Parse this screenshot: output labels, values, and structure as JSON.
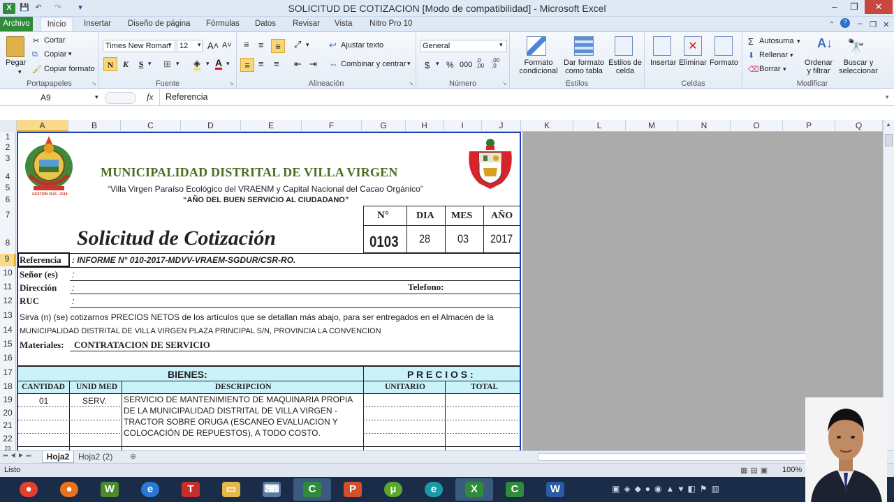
{
  "window": {
    "title": "SOLICITUD DE COTIZACION  [Modo de compatibilidad] - Microsoft Excel",
    "minimize": "–",
    "restore": "❐",
    "close": "✕"
  },
  "ribbon_tabs": [
    "Archivo",
    "Inicio",
    "Insertar",
    "Diseño de página",
    "Fórmulas",
    "Datos",
    "Revisar",
    "Vista",
    "Nitro Pro 10"
  ],
  "ribbon": {
    "portapapeles": {
      "paste": "Pegar",
      "cut": "Cortar",
      "copy": "Copiar",
      "format_painter": "Copiar formato",
      "label": "Portapapeles"
    },
    "fuente": {
      "font_name": "Times New Roman",
      "font_size": "12",
      "bold": "N",
      "italic": "K",
      "underline": "S",
      "label": "Fuente"
    },
    "alineacion": {
      "wrap": "Ajustar texto",
      "merge": "Combinar y centrar",
      "label": "Alineación"
    },
    "numero": {
      "format": "General",
      "currency": "$",
      "percent": "%",
      "thousands": "000",
      "inc": ",0 ,00",
      "dec": ",00 ,0",
      "label": "Número"
    },
    "estilos": {
      "conditional": "Formato condicional",
      "as_table": "Dar formato como tabla",
      "cell_styles": "Estilos de celda",
      "label": "Estilos"
    },
    "celdas": {
      "insert": "Insertar",
      "delete": "Eliminar",
      "format": "Formato",
      "label": "Celdas"
    },
    "modificar": {
      "autosum": "Autosuma",
      "fill": "Rellenar",
      "clear": "Borrar",
      "sort": "Ordenar y filtrar",
      "find": "Buscar y seleccionar",
      "label": "Modificar"
    }
  },
  "formula_bar": {
    "name_box": "A9",
    "fx": "fx",
    "content": "Referencia"
  },
  "columns": [
    "A",
    "B",
    "C",
    "D",
    "E",
    "F",
    "G",
    "H",
    "I",
    "J",
    "K",
    "L",
    "M",
    "N",
    "O",
    "P",
    "Q"
  ],
  "rows": [
    "1",
    "2",
    "3",
    "4",
    "5",
    "6",
    "7",
    "8",
    "9",
    "10",
    "11",
    "12",
    "13",
    "14",
    "15",
    "16",
    "17",
    "18",
    "19",
    "20",
    "21",
    "22",
    "23"
  ],
  "document": {
    "logo_text": "GESTIÓN 2015 - 2018",
    "municipality": "MUNICIPALIDAD DISTRITAL DE VILLA VIRGEN",
    "slogan": "“Villa Virgen Paraíso Ecológico del VRAENM y Capital Nacional  del Cacao Orgánico”",
    "year_name": "“AÑO DEL BUEN SERVICIO AL CIUDADANO”",
    "title": "Solicitud de Cotización",
    "num_header": "N°",
    "num_value": "0103",
    "dia_header": "DIA",
    "dia_value": "28",
    "mes_header": "MES",
    "mes_value": "03",
    "anio_header": "AÑO",
    "anio_value": "2017",
    "referencia_label": "Referencia",
    "referencia_value": ": INFORME N° 010-2017-MDVV-VRAEM-SGDUR/CSR-RO.",
    "senor_label": "Señor (es)",
    "direccion_label": "Dirección",
    "ruc_label": "RUC",
    "colon": ":",
    "telefono_label": "Telefono:",
    "intro_line1": "Sirva  (n)  (se)  cotizarnos  PRECIOS  NETOS   de  los artículos  que  se  detallan  más  abajo, para ser entregados en el Almacén de la",
    "intro_line2": "MUNICIPALIDAD DISTRITAL DE VILLA VIRGEN  PLAZA PRINCIPAL S/N, PROVINCIA LA CONVENCION",
    "materiales_label": "Materiales:",
    "materiales_value": "CONTRATACION DE SERVICIO",
    "bienes_header": "BIENES:",
    "precios_header": "P R E C I O S :",
    "col_cantidad": "CANTIDAD",
    "col_unidad": "UNID MED",
    "col_descripcion": "DESCRIPCION",
    "col_unitario": "UNITARIO",
    "col_total": "TOTAL",
    "item_cantidad": "01",
    "item_unidad": "SERV.",
    "item_desc_1": "SERVICIO DE MANTENIMIENTO DE MAQUINARIA PROPIA",
    "item_desc_2": "DE  LA  MUNICIPALIDAD  DISTRITAL  DE  VILLA  VIRGEN  -",
    "item_desc_3": "TRACTOR  SOBRE  ORUGA  (ESCANEO  EVALUACION  Y",
    "item_desc_4": "COLOCACIÓN DE REPUESTOS), A TODO COSTO."
  },
  "sheet_tabs": [
    "Hoja2",
    "Hoja2 (2)"
  ],
  "status": {
    "ready": "Listo",
    "zoom": "100%"
  },
  "colors": {
    "excel_green": "#2e8b3a",
    "title_green": "#4d6b1f",
    "header_cyan": "#c9f2fb",
    "selection_blue": "#1d3fb8"
  }
}
